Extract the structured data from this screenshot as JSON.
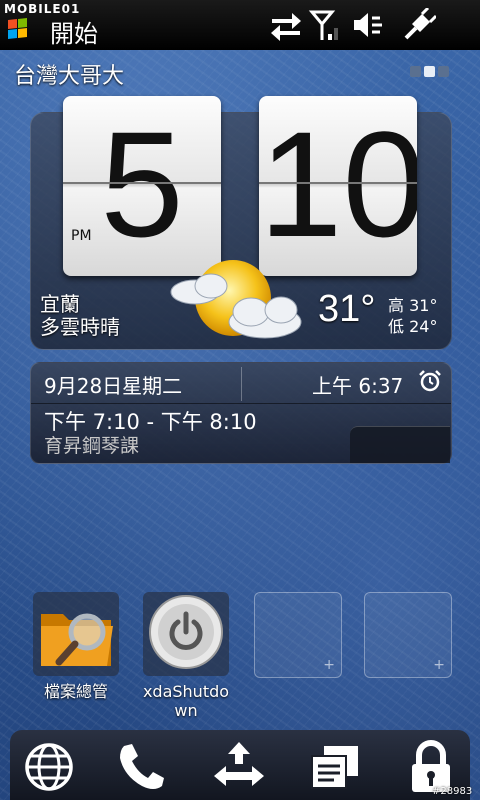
{
  "status_bar": {
    "brand": "MOBILE01",
    "start_label": "開始",
    "icons": [
      "sync-icon",
      "signal-icon",
      "speaker-mute-icon",
      "charging-plug-icon"
    ]
  },
  "home": {
    "carrier": "台灣大哥大",
    "pages": 3,
    "active_page": 1
  },
  "clock": {
    "hour": "5",
    "minute": "10",
    "ampm": "PM"
  },
  "weather": {
    "city": "宜蘭",
    "condition": "多雲時晴",
    "temperature": "31°",
    "high_label": "高 31°",
    "low_label": "低 24°",
    "icon": "partly-cloudy-icon"
  },
  "calendar": {
    "date": "9月28日星期二",
    "alarm": "上午 6:37",
    "event_time": "下午 7:10 - 下午 8:10",
    "event_title": "育昇鋼琴課"
  },
  "apps": [
    {
      "label": "檔案總管",
      "icon": "file-explorer-icon"
    },
    {
      "label": "xdaShutdo\nwn",
      "icon": "power-icon"
    },
    {
      "label": "",
      "icon": ""
    },
    {
      "label": "",
      "icon": ""
    }
  ],
  "bottom_bar": {
    "icons": [
      "internet-globe-icon",
      "phone-icon",
      "switch-arrows-icon",
      "messaging-icon",
      "lock-icon"
    ]
  },
  "watermark": "#28983",
  "colors": {
    "status_bar": "#000000",
    "wallpaper": "#2d5595",
    "panel": "#2c3448"
  }
}
